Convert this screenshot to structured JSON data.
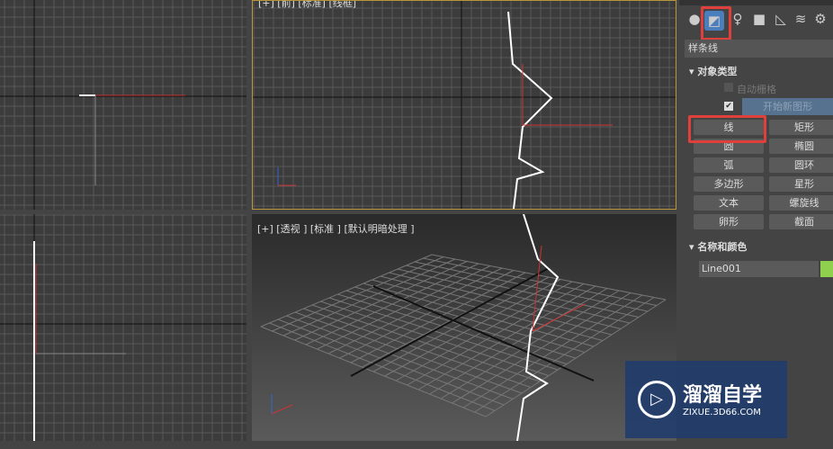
{
  "viewports": {
    "top_label": "[+] [前] [标准] [线框]",
    "persp_label": "[+] [透视 ] [标准 ] [默认明暗处理 ]",
    "axis_x": "x",
    "axis_y": "y",
    "axis_z": "z"
  },
  "panel": {
    "category": "样条线",
    "object_type": {
      "title": "对象类型",
      "autogrid": "自动栅格",
      "start_new": "开始新图形",
      "buttons": [
        "线",
        "矩形",
        "圆",
        "椭圆",
        "弧",
        "圆环",
        "多边形",
        "星形",
        "文本",
        "螺旋线",
        "卵形",
        "截面"
      ]
    },
    "name_color": {
      "title": "名称和颜色",
      "name": "Line001",
      "color": "#8fd14f"
    }
  },
  "watermark": {
    "title": "溜溜自学",
    "url": "ZIXUE.3D66.COM"
  }
}
